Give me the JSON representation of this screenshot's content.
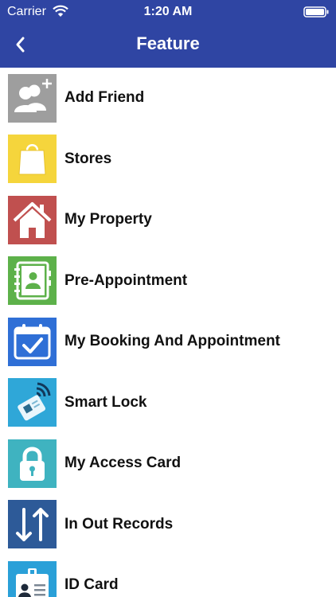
{
  "status_bar": {
    "carrier": "Carrier",
    "time": "1:20 AM"
  },
  "nav": {
    "title": "Feature",
    "back_icon": "chevron-left-icon"
  },
  "colors": {
    "nav": "#2f45a3",
    "add_friend": "#9e9e9e",
    "stores": "#f5d53c",
    "my_property": "#c0504f",
    "pre_appointment": "#5db14a",
    "booking": "#2f6fd6",
    "smart_lock": "#2fa7d8",
    "access_card": "#3fb3c0",
    "in_out": "#2d5a98",
    "id_card": "#2aa0d8"
  },
  "features": [
    {
      "label": "Add Friend",
      "icon": "add-friend-icon"
    },
    {
      "label": "Stores",
      "icon": "shopping-bag-icon"
    },
    {
      "label": "My Property",
      "icon": "house-icon"
    },
    {
      "label": "Pre-Appointment",
      "icon": "address-book-icon"
    },
    {
      "label": "My Booking And Appointment",
      "icon": "calendar-check-icon"
    },
    {
      "label": "Smart Lock",
      "icon": "nfc-card-icon"
    },
    {
      "label": "My Access Card",
      "icon": "padlock-icon"
    },
    {
      "label": "In Out Records",
      "icon": "arrows-up-down-icon"
    },
    {
      "label": "ID Card",
      "icon": "id-card-icon"
    }
  ]
}
